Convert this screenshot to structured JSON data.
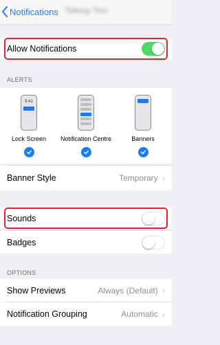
{
  "nav": {
    "back_label": "Notifications",
    "app_name": "Talking Tom"
  },
  "allow_notifications": {
    "label": "Allow Notifications",
    "enabled": true
  },
  "alerts": {
    "header": "ALERTS",
    "lock_screen": {
      "label": "Lock Screen",
      "time": "9:41",
      "checked": true
    },
    "notification_centre": {
      "label": "Notification Centre",
      "checked": true
    },
    "banners": {
      "label": "Banners",
      "checked": true
    }
  },
  "banner_style": {
    "label": "Banner Style",
    "value": "Temporary"
  },
  "sounds": {
    "label": "Sounds",
    "enabled": false
  },
  "badges": {
    "label": "Badges",
    "enabled": false
  },
  "options": {
    "header": "OPTIONS",
    "show_previews": {
      "label": "Show Previews",
      "value": "Always (Default)"
    },
    "notification_grouping": {
      "label": "Notification Grouping",
      "value": "Automatic"
    }
  },
  "colors": {
    "accent_blue": "#1a7cf5",
    "toggle_on_green": "#4cd964",
    "highlight_red": "#e2222c"
  }
}
